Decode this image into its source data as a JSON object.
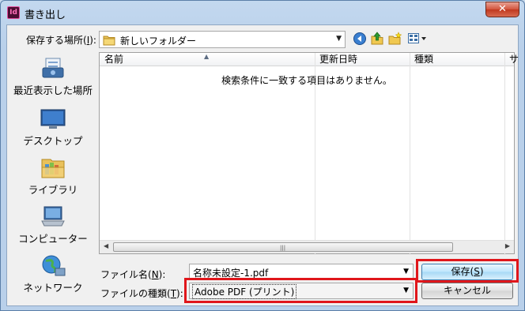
{
  "window": {
    "title": "書き出し",
    "app_icon": "Id",
    "close_glyph": "✕"
  },
  "location": {
    "label": "保存する場所(",
    "key": "I",
    "label_end": "):",
    "value": "新しいフォルダー"
  },
  "places": [
    {
      "label": "最近表示した場所",
      "icon": "recent-places-icon"
    },
    {
      "label": "デスクトップ",
      "icon": "desktop-icon"
    },
    {
      "label": "ライブラリ",
      "icon": "libraries-icon"
    },
    {
      "label": "コンピューター",
      "icon": "computer-icon"
    },
    {
      "label": "ネットワーク",
      "icon": "network-icon"
    }
  ],
  "list": {
    "columns": [
      "名前",
      "更新日時",
      "種類",
      "サ"
    ],
    "empty_message": "検索条件に一致する項目はありません。"
  },
  "filename": {
    "label": "ファイル名(",
    "key": "N",
    "label_end": "):",
    "value": "名称未設定-1.pdf"
  },
  "filetype": {
    "label": "ファイルの種類(",
    "key": "T",
    "label_end": "):",
    "value": "Adobe PDF (プリント)"
  },
  "buttons": {
    "save": "保存(",
    "save_key": "S",
    "save_end": ")",
    "cancel": "キャンセル"
  },
  "colors": {
    "highlight": "#e0161b"
  }
}
